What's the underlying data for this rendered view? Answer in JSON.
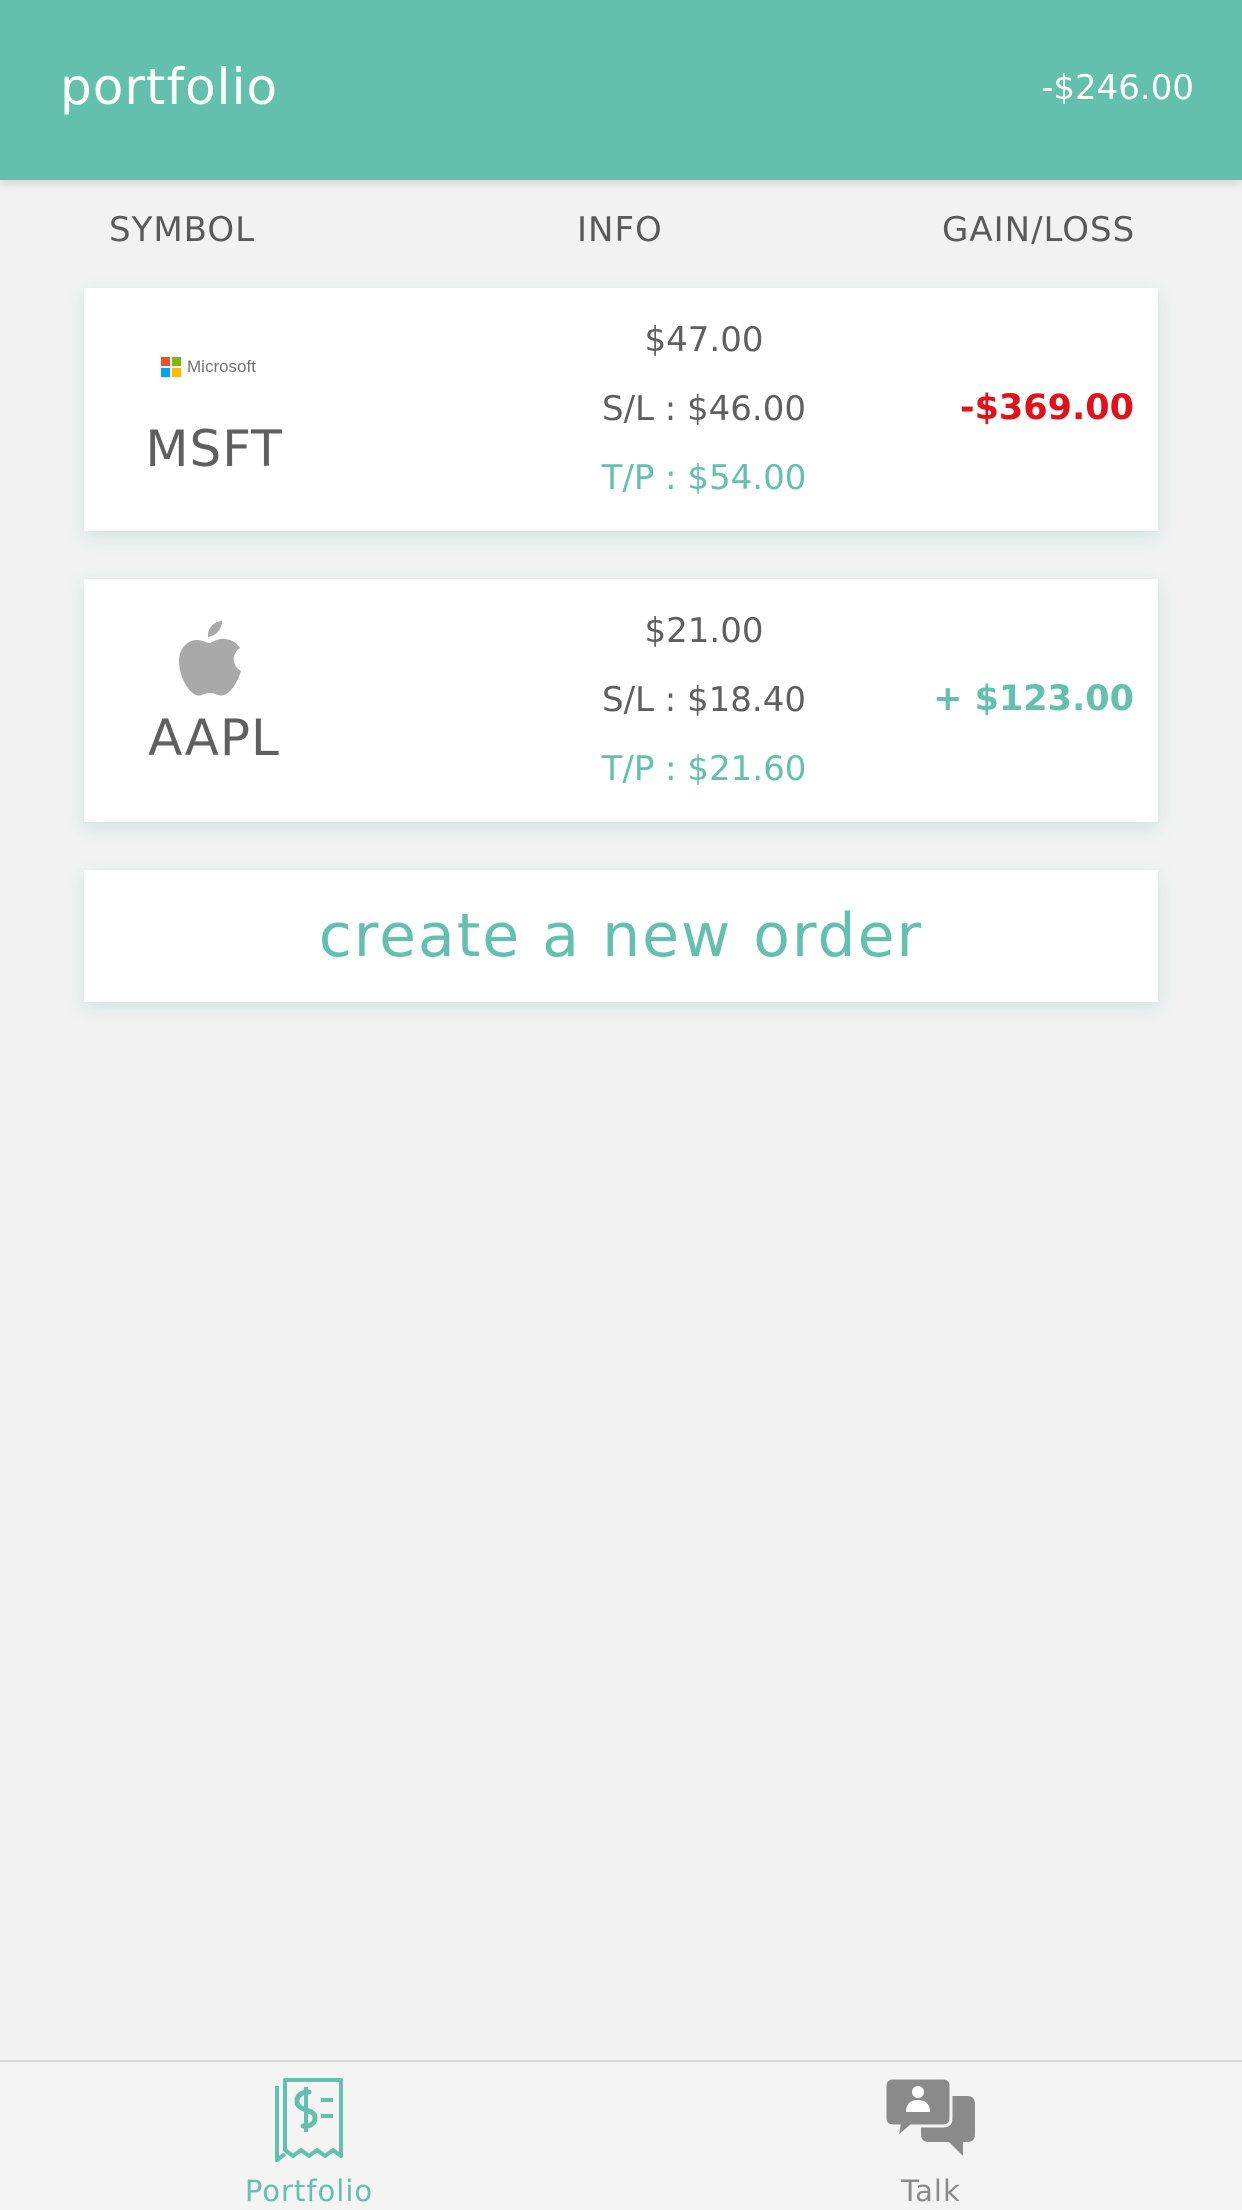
{
  "header": {
    "title": "portfolio",
    "total": "-$246.00"
  },
  "columns": {
    "symbol": "SYMBOL",
    "info": "INFO",
    "gain_loss": "GAIN/LOSS"
  },
  "positions": [
    {
      "logo_icon": "microsoft-logo-icon",
      "logo_text": "Microsoft",
      "symbol": "MSFT",
      "price": "$47.00",
      "stop_loss": "S/L : $46.00",
      "take_profit": "T/P : $54.00",
      "gain_loss": "-$369.00",
      "gain_color": "#e3101a"
    },
    {
      "logo_icon": "apple-logo-icon",
      "symbol": "AAPL",
      "price": "$21.00",
      "stop_loss": "S/L : $18.40",
      "take_profit": "T/P : $21.60",
      "gain_loss": "+ $123.00",
      "gain_color": "#63c0ad"
    }
  ],
  "new_order": {
    "label": "create a new order"
  },
  "tabbar": {
    "tabs": [
      {
        "icon": "receipt-dollar-icon",
        "label": "Portfolio",
        "active": true
      },
      {
        "icon": "chat-bubbles-icon",
        "label": "Talk",
        "active": false
      }
    ]
  },
  "colors": {
    "accent": "#63c0ad",
    "background": "#f2f2f2",
    "loss": "#e3101a",
    "text": "#5f5f5f"
  }
}
